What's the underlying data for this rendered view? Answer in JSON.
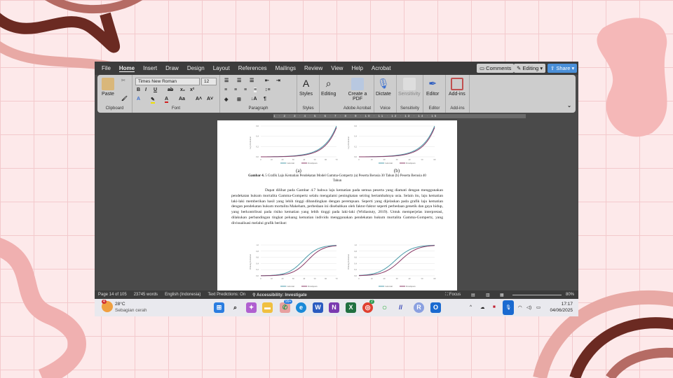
{
  "menu": {
    "tabs": [
      "File",
      "Home",
      "Insert",
      "Draw",
      "Design",
      "Layout",
      "References",
      "Mailings",
      "Review",
      "View",
      "Help",
      "Acrobat"
    ],
    "comments": "Comments",
    "editing": "Editing",
    "share": "Share"
  },
  "ribbon": {
    "paste": "Paste",
    "font_name": "Times New Roman",
    "font_size": "12",
    "styles": "Styles",
    "editing": "Editing",
    "create_pdf": "Create a PDF",
    "dictate": "Dictate",
    "sensitivity": "Sensitivity",
    "editor": "Editor",
    "addins": "Add-ins",
    "groups": {
      "clipboard": "Clipboard",
      "font": "Font",
      "paragraph": "Paragraph",
      "styles": "Styles",
      "acrobat": "Adobe Acrobat",
      "voice": "Voice",
      "sensitivity": "Sensitivity",
      "editor": "Editor",
      "addins": "Add-ins"
    }
  },
  "ruler": "1 · 2 · 3 · 4 · 5 · 6 · 7 · 8 · 9 · 10 · 11 · 12 · 13 · 14 · 15",
  "document": {
    "label_a": "(a)",
    "label_b": "(b)",
    "caption_bold": "Gambar 4.",
    "caption": " 5 Grafik Laju Kematian Pendekatan Model Gamma-Gompertz (a) Peserta Berusia 30 Tahun (b) Peserta Berusia 40 Tahun",
    "paragraph": "Dapat dilihat pada Gambar 4.7 bahwa laju kematian pada semua peserta yang diamati dengan menggunakan pendekatan hukum mortalita Gamma-Gompertz selalu mengalami peningkatan seiring bertambahnya usia. Selain itu, laju kematian laki-laki memberikan hasil yang lebih tinggi dibandingkan dengan perempuan. Seperti yang dijelaskan pada grafik laju kematian dengan pendekatan hukum mortalita Makeham, perbedaan ini disebabkan oleh faktor-faktor seperti perbedaan genetik dan gaya hidup, yang berkontribusi pada risiko kematian yang lebih tinggi pada laki-laki (Widiastuty, 2019). Untuk memperjelas interpretasi, dilakukan perbandingan tingkat peluang kematian individu menggunakan pendekatan hukum mortalita Gamma-Gompertz, yang divisualisasi melalui grafik berikut:",
    "legend": [
      "Laki-laki",
      "Perempuan"
    ],
    "colors": [
      "#4a9aa8",
      "#8a3a66"
    ],
    "top_ylabel": "Laju Kematian",
    "bottom_ylabel": "Peluang Kematian",
    "top_yticks": [
      "0,0",
      "0,2",
      "0,4",
      "0,6"
    ],
    "bottom_yticks": [
      "0,0",
      "0,2",
      "0,4",
      "0,6",
      "0,8",
      "1,0"
    ],
    "xticks_a": [
      "0",
      "10",
      "20",
      "30",
      "40",
      "50",
      "60",
      "70"
    ],
    "xticks_b": [
      "0",
      "10",
      "20",
      "30",
      "40",
      "50",
      "60"
    ]
  },
  "status": {
    "page": "Page 14 of 105",
    "words": "23745 words",
    "language": "English (Indonesia)",
    "predictions": "Text Predictions: On",
    "accessibility": "Accessibility: Investigate",
    "focus": "Focus",
    "zoom": "80%"
  },
  "taskbar": {
    "temp": "28°C",
    "weather": "Sebagian cerah",
    "weather_badge": "4",
    "whatsapp_badge": "99+",
    "chrome_badge": "2",
    "time": "17:17",
    "date": "04/06/2025"
  }
}
